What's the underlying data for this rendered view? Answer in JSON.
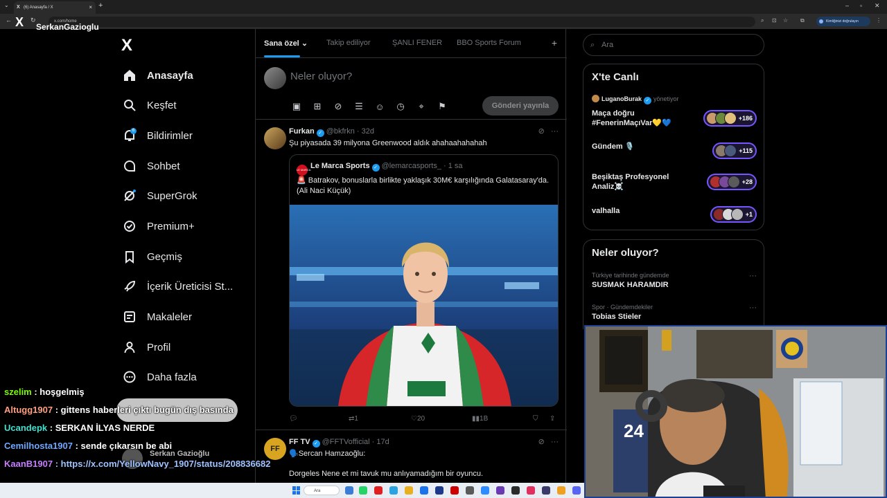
{
  "browser": {
    "tab_title": "(6) Anasayfa / X",
    "url": "x.com/home",
    "identity_chip": "Kimliğinizi doğrulayın"
  },
  "stream_overlay": {
    "logo": "X",
    "name": "SerkanGazioglu"
  },
  "nav": {
    "logo": "X",
    "notification_count": "6",
    "items": [
      {
        "label": "Anasayfa",
        "icon": "home-icon"
      },
      {
        "label": "Keşfet",
        "icon": "search-icon"
      },
      {
        "label": "Bildirimler",
        "icon": "bell-icon"
      },
      {
        "label": "Sohbet",
        "icon": "chat-icon"
      },
      {
        "label": "SuperGrok",
        "icon": "grok-icon"
      },
      {
        "label": "Premium+",
        "icon": "verified-icon"
      },
      {
        "label": "Geçmiş",
        "icon": "bookmark-icon"
      },
      {
        "label": "İçerik Üreticisi St...",
        "icon": "rocket-icon"
      },
      {
        "label": "Makaleler",
        "icon": "article-icon"
      },
      {
        "label": "Profil",
        "icon": "person-icon"
      },
      {
        "label": "Daha fazla",
        "icon": "more-icon"
      }
    ],
    "account_name": "Serkan Gazioğlu"
  },
  "feed": {
    "tabs": [
      "Sana özel",
      "Takip ediliyor",
      "ŞANLI FENER",
      "BBO Sports Forum"
    ],
    "composer_placeholder": "Neler oluyor?",
    "post_button": "Gönderi yayınla",
    "tweets": [
      {
        "name": "Furkan",
        "handle": "@bkfrkn",
        "time": "· 32d",
        "text": "Şu piyasada 39 milyona Greenwood aldık ahahaahahahah",
        "quote": {
          "name": "Le Marca Sports",
          "handle": "@lemarcasports_",
          "time": "· 1 sa",
          "text": "🚨 Batrakov, bonuslarla birlikte yaklaşık 30M€ karşılığında Galatasaray'da. (Ali Naci Küçük)"
        },
        "stats": {
          "replies": "",
          "reposts": "1",
          "likes": "20",
          "views": "1B"
        }
      },
      {
        "name": "FF TV",
        "handle": "@FFTVofficial",
        "time": "· 17d",
        "line1": "🗣️Sercan Hamzaoğlu:",
        "line2": "Dorgeles Nene et mi tavuk mu anlıyamadığım bir oyuncu."
      }
    ]
  },
  "sidebar": {
    "search_placeholder": "Ara",
    "live": {
      "title": "X'te Canlı",
      "host": "LuganoBurak",
      "host_suffix": "yönetiyor",
      "spaces": [
        {
          "title": "Maça doğru #FenerinMaçıVar💛💙",
          "count": "+186"
        },
        {
          "title": "Gündem 🎙️",
          "count": "+115"
        },
        {
          "title": "Beşiktaş Profesyonel Analiz☠️",
          "count": "+28"
        },
        {
          "title": "valhalla",
          "count": "+1"
        }
      ]
    },
    "trends": {
      "title": "Neler oluyor?",
      "items": [
        {
          "meta": "Türkiye tarihinde gündemde",
          "name": "SUSMAK HARAMDIR"
        },
        {
          "meta": "Spor · Gündemdekiler",
          "name": "Tobias Stieler"
        }
      ]
    }
  },
  "chat": [
    {
      "user": "szelim",
      "message": " : hoşgelmiş",
      "color": "#7cfc00"
    },
    {
      "user": "Altugg1907",
      "message": " : gittens haberleri çıktı bugün dış basında",
      "color": "#ff9f80"
    },
    {
      "user": "Ucandepk",
      "message": " : SERKAN İLYAS NERDE",
      "color": "#40e0d0"
    },
    {
      "user": "Cemilhosta1907",
      "message": " : sende çıkarsın be abi",
      "color": "#6fa8ff"
    },
    {
      "user": "KaanB1907",
      "message": " : https://x.com/YellowNavy_1907/status/208836682",
      "color": "#c77dff",
      "message_color": "#9ec3ff"
    }
  ],
  "taskbar": {
    "search": "Ara"
  },
  "colors": {
    "accent": "#1d9bf0",
    "live_border": "#7856ff",
    "background": "#000000"
  }
}
